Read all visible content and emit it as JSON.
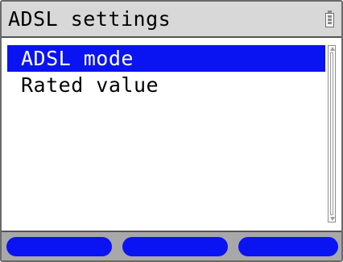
{
  "title_bar": {
    "title": "ADSL settings",
    "battery_icon": "battery-icon"
  },
  "menu": {
    "items": [
      {
        "label": "ADSL mode",
        "selected": true
      },
      {
        "label": "Rated value",
        "selected": false
      }
    ]
  },
  "softkeys": [
    {
      "label": ""
    },
    {
      "label": ""
    },
    {
      "label": ""
    }
  ],
  "colors": {
    "selection": "#0a14f2",
    "title_bar_background": "#d8d8d8",
    "softkey_bar_background": "#a8a8a8",
    "softkey": "#0a14f2"
  }
}
